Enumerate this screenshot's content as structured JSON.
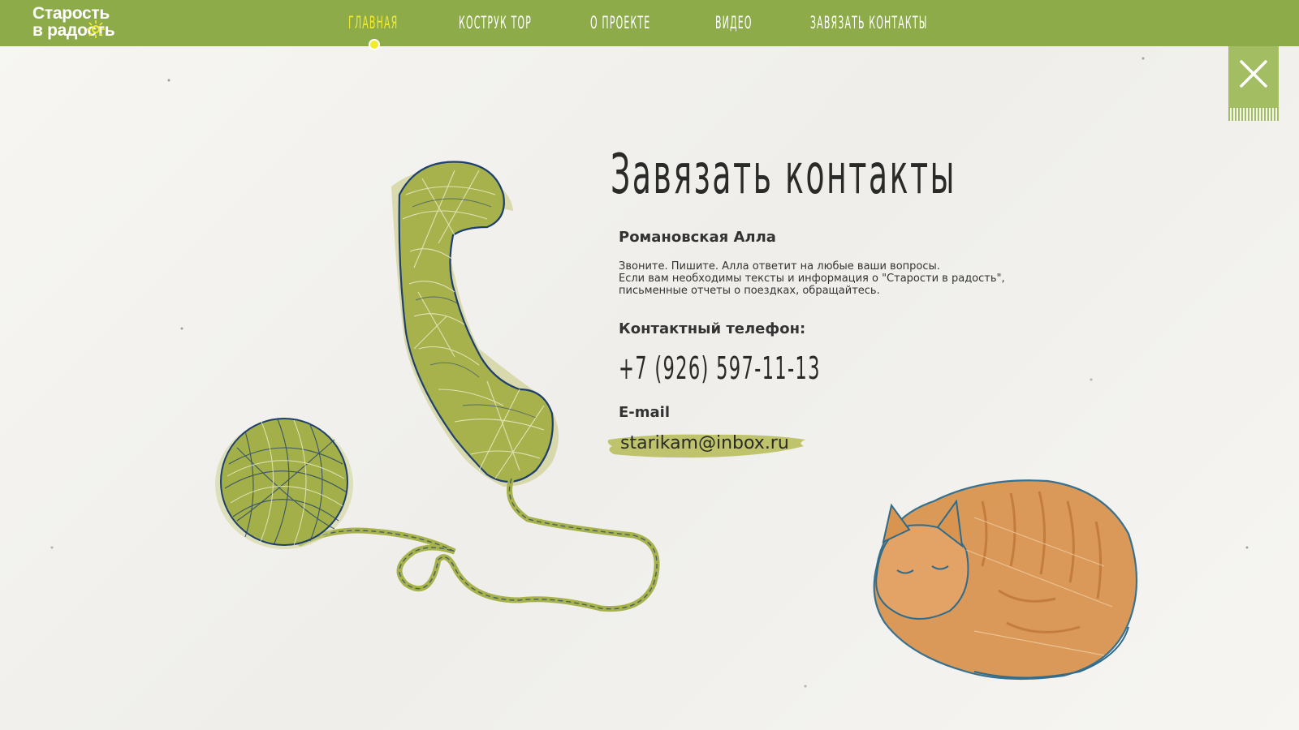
{
  "header": {
    "logo_line1": "Старость",
    "logo_line2": "в радость",
    "nav": [
      {
        "label": "Главная",
        "active": true
      },
      {
        "label": "Кострук тор",
        "active": false
      },
      {
        "label": "О проекте",
        "active": false
      },
      {
        "label": "Видео",
        "active": false
      },
      {
        "label": "Завязать контакты",
        "active": false
      }
    ]
  },
  "content": {
    "title": "Завязать контакты",
    "person_name": "Романовская Алла",
    "description_lines": [
      "Звоните. Пишите. Алла ответит на любые ваши вопросы.",
      "Если вам необходимы тексты и информация о \"Старости в радость\",",
      "письменные отчеты о поездках, обращайтесь."
    ],
    "phone_label": "Контактный телефон:",
    "phone": "+7 (926) 597-11-13",
    "email_label": "E-mail",
    "email": "starikam@inbox.ru"
  },
  "icons": {
    "close": "close-icon",
    "phone_illustration": "yarn-telephone-illustration",
    "yarn_ball": "yarn-ball-illustration",
    "cat": "sleeping-cat-illustration",
    "logo_sun": "sun-icon"
  },
  "colors": {
    "header_bg": "#8eab4a",
    "nav_active": "#f2ea2c",
    "yarn_green": "#a7b24c",
    "yarn_outline": "#1f3f6e",
    "cat_orange": "#d99550",
    "background": "#f5f4f0"
  }
}
